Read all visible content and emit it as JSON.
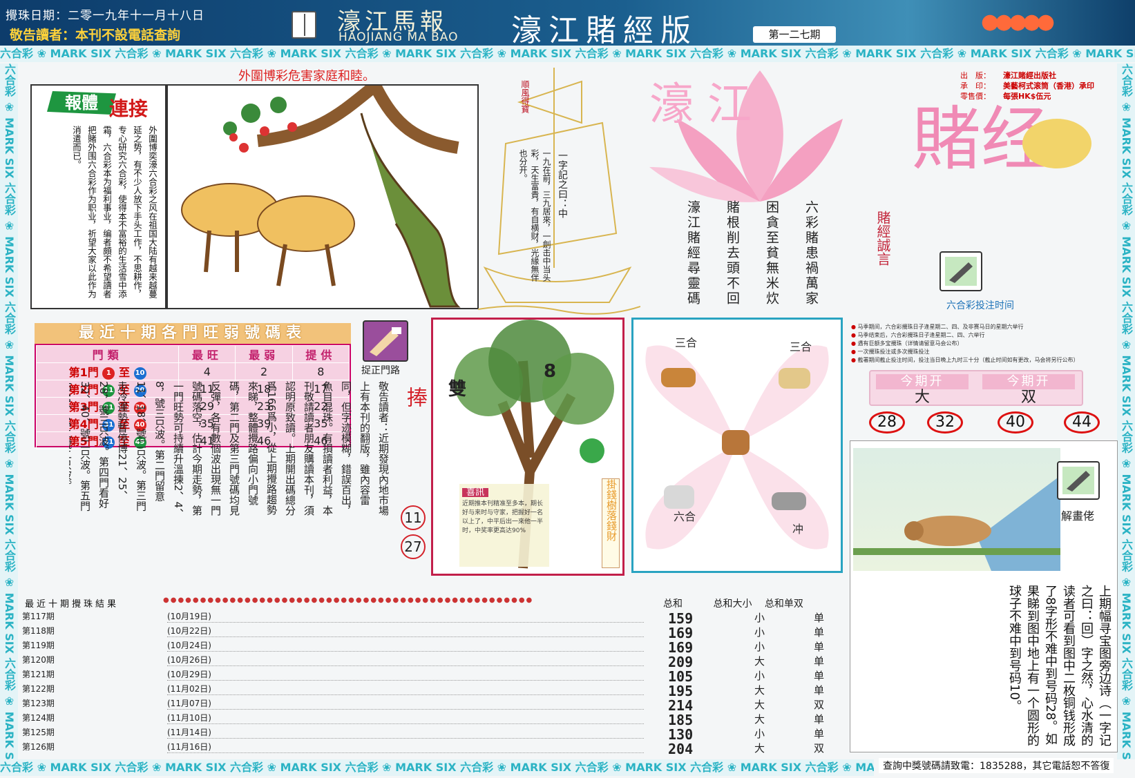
{
  "header": {
    "date_line": "攪珠日期：二零一九年十一月十八日",
    "warning": "敬告讀者：本刊不設電話查詢",
    "logo_cn": "濠江馬報",
    "logo_en": "HAOJIANG MA BAO",
    "edition_name": "濠江賭經版",
    "issue": "第一二七期"
  },
  "border_text": "六合彩 ❀ MARK SIX 六合彩 ❀ MARK SIX 六合彩 ❀ MARK SIX 六合彩 ❀ MARK SIX 六合彩 ❀ MARK SIX 六合彩 ❀ MARK SIX 六合彩 ❀ MARK SIX 六合彩 ❀ MARK SIX 六合彩 ❀ MARK SIX 六合彩 ❀ MARK SIX",
  "colors": {
    "accent_pink": "#f08ab5",
    "red": "#d4222a",
    "teal": "#2bb3c4",
    "navy": "#0d3c6b"
  },
  "tagline": "外圍博彩危害家庭和睦。",
  "article": {
    "head_green": "報體",
    "head_red": "連接",
    "body": "外圍博奕濠六合彩之风在祖国大陆有越来越蔓延之势，有不少人放下手头工作，不思耕作，专心研究六合彩，使得本不富裕的生活雪中添霜，六合彩本为福利事业，编者頗不希望讀者把賭外围六合彩作为职业，祈望大家以此作为消遣而已。"
  },
  "sailboat": {
    "sign": "順風得寶",
    "verse_title": "一字記之曰：中",
    "verse": "一九在前，三九居來，一劍击中当头彩，天生富貴，有自横财，光緣無伴也分开。"
  },
  "poem": {
    "lines": [
      "六彩賭患禍萬家",
      "困貪至貧無米炊",
      "賭根削去頭不回",
      "濠江賭經尋靈碼"
    ],
    "motto": "賭經誠言"
  },
  "title_art": {
    "line1": "濠江",
    "line2": "賭经"
  },
  "publisher": {
    "rows": [
      {
        "label": "出　版：",
        "value": "濠江賭經出版社"
      },
      {
        "label": "承　印：",
        "value": "美藝柯式滚筒（香港）承印"
      },
      {
        "label": "零售價：",
        "value": "每張HK$伍元"
      }
    ]
  },
  "schedule": {
    "title": "六合彩投注时间",
    "items": [
      "马季期间，六合彩攪珠日子逢星期二、四、及非赛马日的星期六举行",
      "马季结束后，六合彩攪珠日子逢星期二、四、六举行",
      "遇有巨额多宝攪珠（详情请留意马会公布）",
      "一次攪珠投注或多次攪珠投注",
      "截署期间截止投注时间，投注当日晚上九时三十分（截止时间如有更改，马会将另行公布）"
    ]
  },
  "current_period": {
    "label_a": "今期开",
    "value_a": "大",
    "label_b": "今期开",
    "value_b": "双",
    "numbers": [
      "28",
      "32",
      "40",
      "44"
    ]
  },
  "gate_table": {
    "title": "最近十期各門旺弱號碼表",
    "headers": [
      "門類",
      "最旺",
      "最弱",
      "提供"
    ],
    "rows": [
      {
        "gate": "第1門",
        "from": "1",
        "to": "10",
        "hot": "4",
        "cold": "2",
        "pick": "8"
      },
      {
        "gate": "第2門",
        "from": "11",
        "to": "20",
        "hot": "11",
        "cold": "18",
        "pick": "17"
      },
      {
        "gate": "第3門",
        "from": "21",
        "to": "30",
        "hot": "29",
        "cold": "23",
        "pick": "22"
      },
      {
        "gate": "第4門",
        "from": "31",
        "to": "40",
        "hot": "35",
        "cold": "39",
        "pick": "35"
      },
      {
        "gate": "第5門",
        "from": "41",
        "to": "49",
        "hot": "41",
        "cold": "46",
        "pick": "46"
      }
    ],
    "connector": "至"
  },
  "gate_label": "捉正門路",
  "hot_numbers": {
    "title": "旺门号码当捧",
    "balls": [
      "11",
      "27"
    ]
  },
  "gate_article": "敬告讀者：近期發現內地市場上有本刊的翻版，雖內容雷同，但字迹模糊，錯誤百出，魚目混珠。有損讀者利益，本刊敬請讀者朋友購讀本刊，須認明原致讀。上期開出碼總分爲166爲小，從上期攪路趨勢來睇，整體攪路偏向小門號碼，第二門及第三門號碼均見反彈，各有數個波出現無一門號碼落空，估計今期走勢，第一門旺勢可持續升溫揀2、4、8，號三只波。第二門留意11、18、號二只波。第三門走冷運勢暫停博21、25、28，號三只波。第四門看好32、40、號二只波。第五門防41、45二號二只波。",
  "tree_box": {
    "char_left": "雙",
    "char_right": "8",
    "tip_title": "喜訊",
    "tip_text": "近期推本刊精准至多本，期长好与来时与守家，把握好一名以上了，中平后出一來他一半时，中奖率更高达90%",
    "side_tag": "掛錢樹落錢財"
  },
  "zodiac": {
    "labels": {
      "top_left": "三合",
      "top_right": "三合",
      "bottom_left": "六合",
      "bottom_right": "冲"
    }
  },
  "draw_results": {
    "title": "最近十期攪珠結果",
    "headers": {
      "sum": "总和",
      "big_small": "总和大小",
      "odd_even": "总和单双"
    },
    "rows": [
      {
        "period": "第117期",
        "date": "(10月19日)",
        "sum": "159",
        "bs": "小",
        "oe": "单"
      },
      {
        "period": "第118期",
        "date": "(10月22日)",
        "sum": "169",
        "bs": "小",
        "oe": "单"
      },
      {
        "period": "第119期",
        "date": "(10月24日)",
        "sum": "169",
        "bs": "小",
        "oe": "单"
      },
      {
        "period": "第120期",
        "date": "(10月26日)",
        "sum": "209",
        "bs": "大",
        "oe": "单"
      },
      {
        "period": "第121期",
        "date": "(10月29日)",
        "sum": "105",
        "bs": "小",
        "oe": "单"
      },
      {
        "period": "第122期",
        "date": "(11月02日)",
        "sum": "195",
        "bs": "大",
        "oe": "单"
      },
      {
        "period": "第123期",
        "date": "(11月07日)",
        "sum": "214",
        "bs": "大",
        "oe": "双"
      },
      {
        "period": "第124期",
        "date": "(11月10日)",
        "sum": "185",
        "bs": "大",
        "oe": "单"
      },
      {
        "period": "第125期",
        "date": "(11月14日)",
        "sum": "130",
        "bs": "小",
        "oe": "单"
      },
      {
        "period": "第126期",
        "date": "(11月16日)",
        "sum": "204",
        "bs": "大",
        "oe": "双"
      }
    ]
  },
  "riddle": {
    "label": "解畫佬",
    "text": "上期幅寻宝图旁边诗（一字记之曰：回）字之然，心水清的读者可看到图中二枚铜钱形成了8字形不难中到号码28。如果睇到图中地上有一个圆形的球子不难中到号码10。"
  },
  "hotline": "查詢中獎號碼請致電：1835288，其它電話恕不答復"
}
